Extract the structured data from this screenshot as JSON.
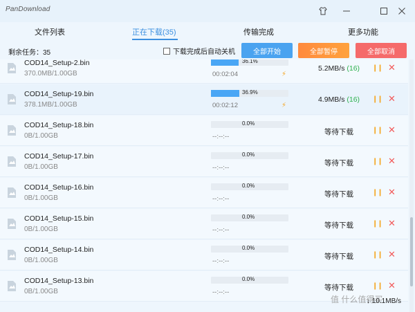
{
  "app": {
    "title": "PanDownload"
  },
  "tabs": [
    {
      "label": "文件列表"
    },
    {
      "label": "正在下载(35)"
    },
    {
      "label": "传输完成"
    },
    {
      "label": "更多功能"
    }
  ],
  "toolbar": {
    "remaining": "剩余任务：35",
    "auto_shutdown": "下载完成后自动关机",
    "start_all": "全部开始",
    "pause_all": "全部暂停",
    "cancel_all": "全部取消"
  },
  "downloads": [
    {
      "name": "COD14_Setup-2.bin",
      "size": "370.0MB/1.00GB",
      "percent": "36.1%",
      "progress": 0.361,
      "elapsed": "00:02:04",
      "speed": "5.2MB/s ",
      "conn": "(16)",
      "status": ""
    },
    {
      "name": "COD14_Setup-19.bin",
      "size": "378.1MB/1.00GB",
      "percent": "36.9%",
      "progress": 0.369,
      "elapsed": "00:02:12",
      "speed": "4.9MB/s ",
      "conn": "(16)",
      "status": ""
    },
    {
      "name": "COD14_Setup-18.bin",
      "size": "0B/1.00GB",
      "percent": "0.0%",
      "progress": 0,
      "elapsed": "--:--:--",
      "speed": "",
      "conn": "",
      "status": "等待下载"
    },
    {
      "name": "COD14_Setup-17.bin",
      "size": "0B/1.00GB",
      "percent": "0.0%",
      "progress": 0,
      "elapsed": "--:--:--",
      "speed": "",
      "conn": "",
      "status": "等待下载"
    },
    {
      "name": "COD14_Setup-16.bin",
      "size": "0B/1.00GB",
      "percent": "0.0%",
      "progress": 0,
      "elapsed": "--:--:--",
      "speed": "",
      "conn": "",
      "status": "等待下载"
    },
    {
      "name": "COD14_Setup-15.bin",
      "size": "0B/1.00GB",
      "percent": "0.0%",
      "progress": 0,
      "elapsed": "--:--:--",
      "speed": "",
      "conn": "",
      "status": "等待下载"
    },
    {
      "name": "COD14_Setup-14.bin",
      "size": "0B/1.00GB",
      "percent": "0.0%",
      "progress": 0,
      "elapsed": "--:--:--",
      "speed": "",
      "conn": "",
      "status": "等待下载"
    },
    {
      "name": "COD14_Setup-13.bin",
      "size": "0B/1.00GB",
      "percent": "0.0%",
      "progress": 0,
      "elapsed": "--:--:--",
      "speed": "",
      "conn": "",
      "status": "等待下载"
    }
  ],
  "footer": {
    "total_speed": "10.1MB/s",
    "watermark": "值 什么值得买"
  },
  "colors": {
    "accent": "#3b8fe0",
    "progress": "#49a6f5",
    "pause": "#f5a623",
    "cancel": "#f25a5a",
    "conn": "#2eb24e"
  }
}
